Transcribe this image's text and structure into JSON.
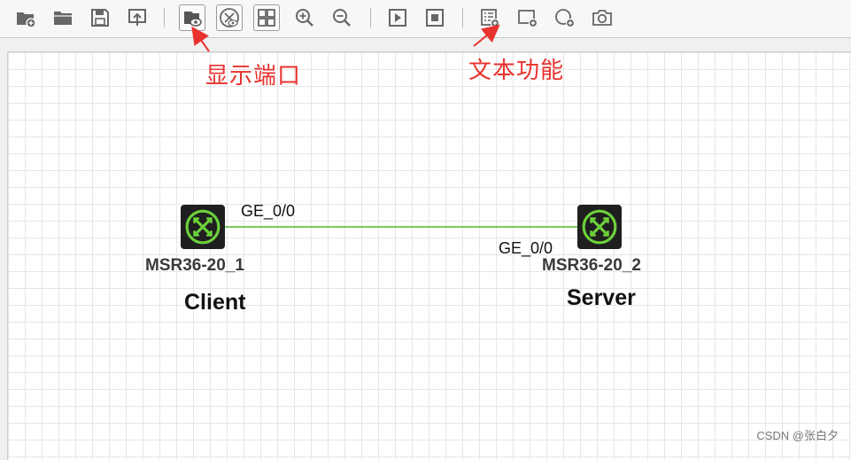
{
  "toolbar": {
    "buttons": [
      {
        "name": "new-project-icon"
      },
      {
        "name": "open-folder-icon"
      },
      {
        "name": "save-icon"
      },
      {
        "name": "export-icon"
      },
      {
        "name": "show-port-icon"
      },
      {
        "name": "topology-icon"
      },
      {
        "name": "grid-icon"
      },
      {
        "name": "zoom-in-icon"
      },
      {
        "name": "zoom-out-icon"
      },
      {
        "name": "start-icon"
      },
      {
        "name": "stop-icon"
      },
      {
        "name": "text-icon"
      },
      {
        "name": "add-rectangle-icon"
      },
      {
        "name": "add-ellipse-icon"
      },
      {
        "name": "screenshot-icon"
      }
    ]
  },
  "annotations": {
    "show_port": "显示端口",
    "text_function": "文本功能",
    "color": "#e8322f"
  },
  "devices": [
    {
      "name": "MSR36-20_1",
      "role": "Client",
      "port": "GE_0/0"
    },
    {
      "name": "MSR36-20_2",
      "role": "Server",
      "port": "GE_0/0"
    }
  ],
  "link_color": "#6cc04a",
  "watermark": "CSDN @张白夕"
}
